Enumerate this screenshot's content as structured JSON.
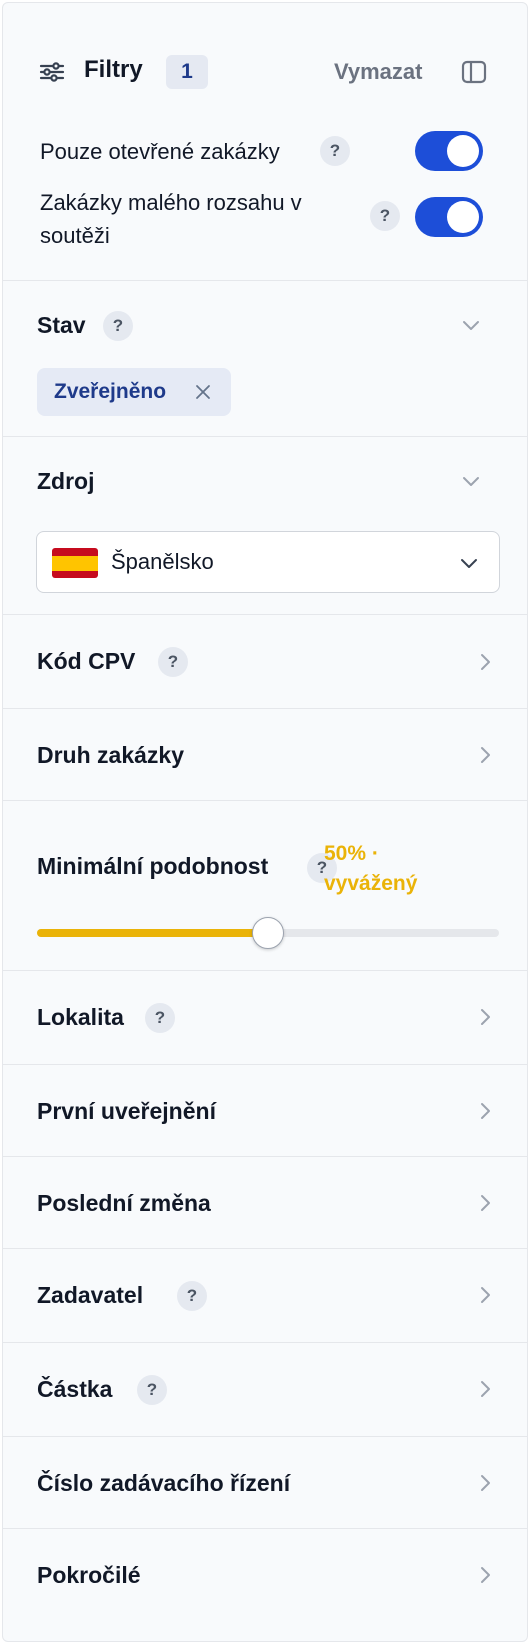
{
  "header": {
    "title": "Filtry",
    "active_count": "1",
    "clear_label": "Vymazat",
    "filters_icon": "sliders-icon",
    "collapse_icon": "sidebar-panel-icon"
  },
  "toggles": [
    {
      "label": "Pouze otevřené zakázky",
      "help": "?",
      "on": true
    },
    {
      "label_line1": "Zakázky malého rozsahu v",
      "label_line2": "soutěži",
      "help": "?",
      "on": true
    }
  ],
  "status": {
    "title": "Stav",
    "help": "?",
    "chip_label": "Zveřejněno"
  },
  "source": {
    "title": "Zdroj",
    "selected": "Španělsko",
    "flag_colors": [
      "#c60b1e",
      "#ffc400",
      "#c60b1e"
    ]
  },
  "cpv": {
    "title": "Kód CPV",
    "help": "?"
  },
  "contract_type": {
    "title": "Druh zakázky"
  },
  "similarity": {
    "title": "Minimální podobnost",
    "help": "?",
    "value_line1": "50% ·",
    "value_line2": "vyvážený",
    "percent": 50
  },
  "sections": [
    {
      "title": "Lokalita",
      "help": "?"
    },
    {
      "title": "První uveřejnění",
      "help": ""
    },
    {
      "title": "Poslední změna",
      "help": ""
    },
    {
      "title": "Zadavatel",
      "help": "?"
    },
    {
      "title": "Částka",
      "help": "?"
    },
    {
      "title": "Číslo zadávacího řízení",
      "help": ""
    },
    {
      "title": "Pokročilé",
      "help": ""
    }
  ],
  "colors": {
    "accent": "#1d4ed8",
    "slider": "#eab308",
    "chip_text": "#1e3a8a"
  }
}
